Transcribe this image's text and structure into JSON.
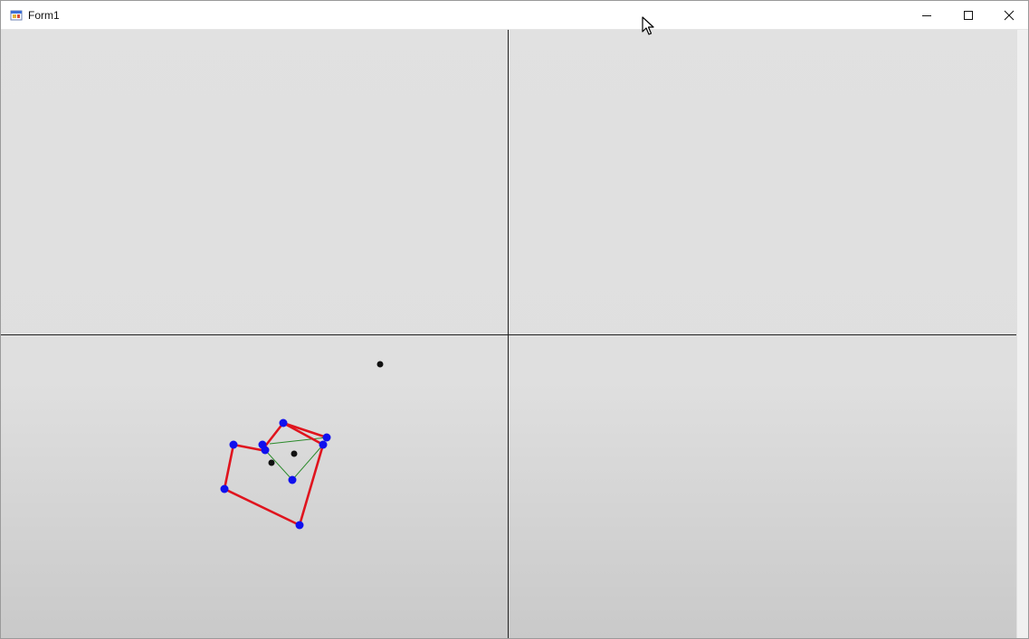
{
  "window": {
    "title": "Form1",
    "icon": "winforms-app-icon",
    "controls": {
      "minimize": "minimize-icon",
      "maximize": "maximize-icon",
      "close": "close-icon"
    }
  },
  "colors": {
    "polygon_edge": "#e0141e",
    "vertex": "#1010ee",
    "diagonal": "#2a8a2a",
    "marker": "#111111",
    "divider": "#222222"
  }
}
